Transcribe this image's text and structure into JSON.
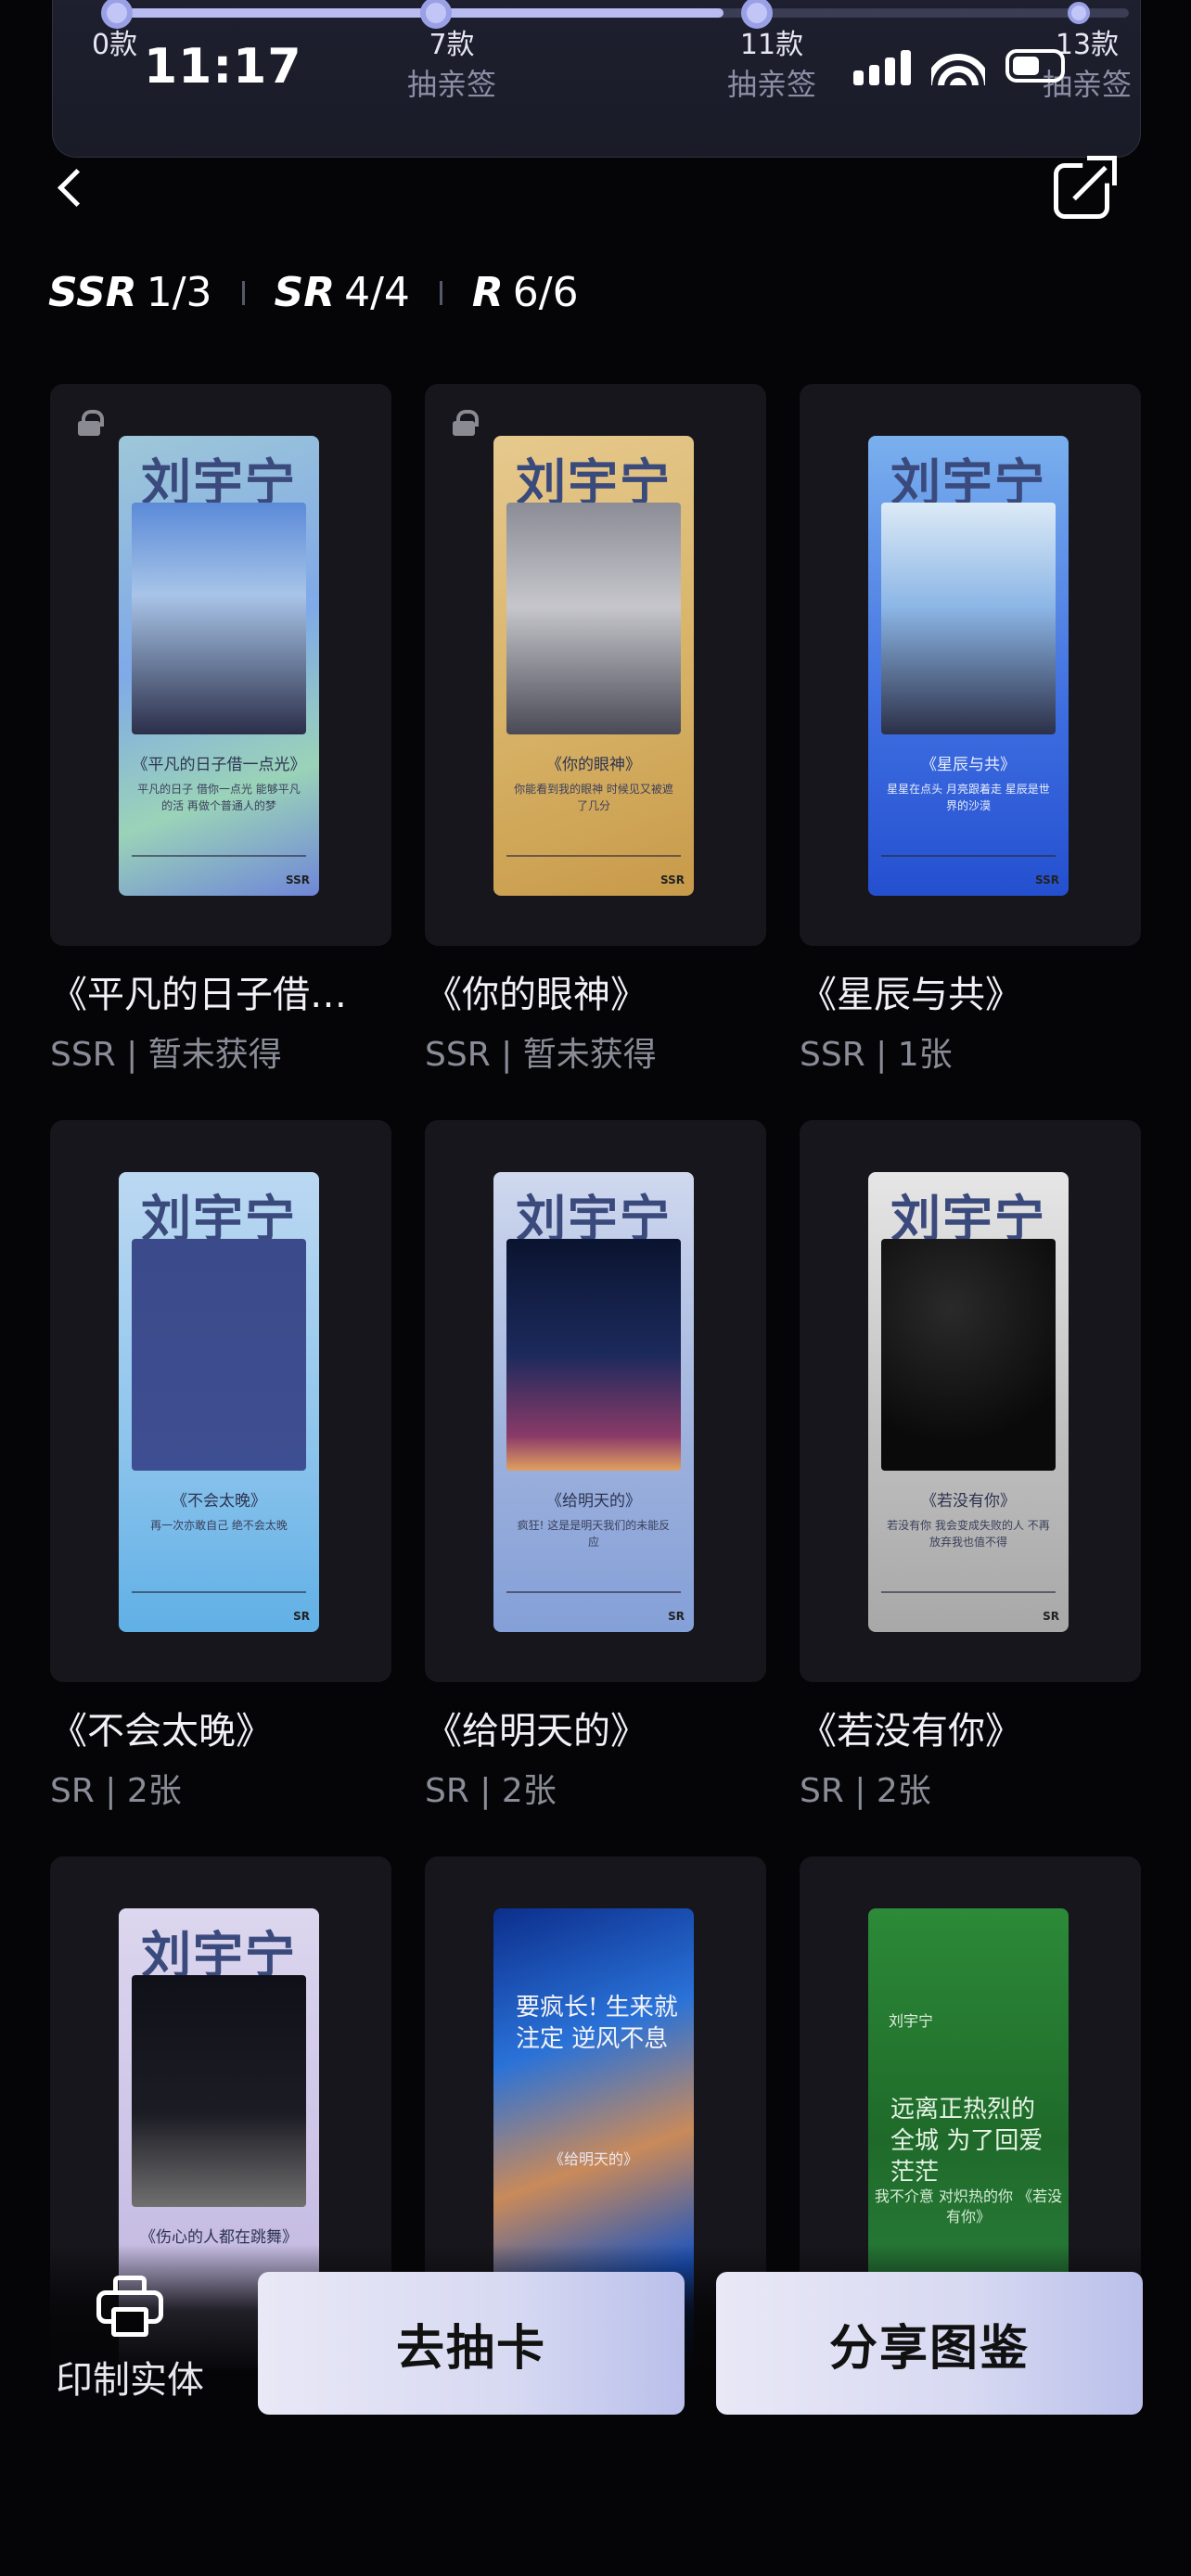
{
  "status_bar": {
    "time": "11:17"
  },
  "progress": {
    "fill_fraction": 0.6,
    "milestones": [
      {
        "count": "0款",
        "label": ""
      },
      {
        "count": "7款",
        "label": "抽亲签"
      },
      {
        "count": "11款",
        "label": "抽亲签"
      },
      {
        "count": "13款",
        "label": "抽亲签"
      }
    ]
  },
  "rarity": [
    {
      "tier": "SSR",
      "count": "1/3"
    },
    {
      "tier": "SR",
      "count": "4/4"
    },
    {
      "tier": "R",
      "count": "6/6"
    }
  ],
  "cards": [
    {
      "title": "《平凡的日子借…",
      "meta": "SSR | 暂未获得",
      "locked": true,
      "poster_name": "刘宇宁",
      "caption": "《平凡的日子借一点光》",
      "sub": "平凡的日子 借你一点光 能够平凡的活 再做个普通人的梦",
      "tag": "SSR"
    },
    {
      "title": "《你的眼神》",
      "meta": "SSR | 暂未获得",
      "locked": true,
      "poster_name": "刘宇宁",
      "caption": "《你的眼神》",
      "sub": "你能看到我的眼神 时候见又被遮了几分",
      "tag": "SSR"
    },
    {
      "title": "《星辰与共》",
      "meta": "SSR | 1张",
      "locked": false,
      "poster_name": "刘宇宁",
      "caption": "《星辰与共》",
      "sub": "星星在点头 月亮跟着走 星辰是世界的沙漠",
      "tag": "SSR"
    },
    {
      "title": "《不会太晚》",
      "meta": "SR | 2张",
      "locked": false,
      "poster_name": "刘宇宁",
      "caption": "《不会太晚》",
      "sub": "再一次亦敢自己 绝不会太晚",
      "tag": "SR"
    },
    {
      "title": "《给明天的》",
      "meta": "SR | 2张",
      "locked": false,
      "poster_name": "刘宇宁",
      "caption": "《给明天的》",
      "sub": "疯狂! 这是是明天我们的未能反应",
      "tag": "SR"
    },
    {
      "title": "《若没有你》",
      "meta": "SR | 2张",
      "locked": false,
      "poster_name": "刘宇宁",
      "caption": "《若没有你》",
      "sub": "若没有你 我会变成失败的人 不再放弃我也值不得",
      "tag": "SR"
    },
    {
      "title": "",
      "meta": "",
      "locked": false,
      "poster_name": "刘宇宁",
      "caption": "《伤心的人都在跳舞》",
      "sub": "",
      "tag": ""
    },
    {
      "title": "",
      "meta": "",
      "locked": false,
      "poster_name": "",
      "caption": "",
      "big": "要疯长! 生来就注定 逆风不息",
      "side": "《给明天的》",
      "tag": ""
    },
    {
      "title": "",
      "meta": "",
      "locked": false,
      "poster_name": "刘宇宁",
      "caption": "",
      "big": "远离正热烈的全城 为了回爱茫茫",
      "side": "我不介意 对炽热的你 《若没有你》",
      "tag": ""
    }
  ],
  "bottom": {
    "print_label": "印制实体",
    "draw_button": "去抽卡",
    "share_button": "分享图鉴"
  }
}
